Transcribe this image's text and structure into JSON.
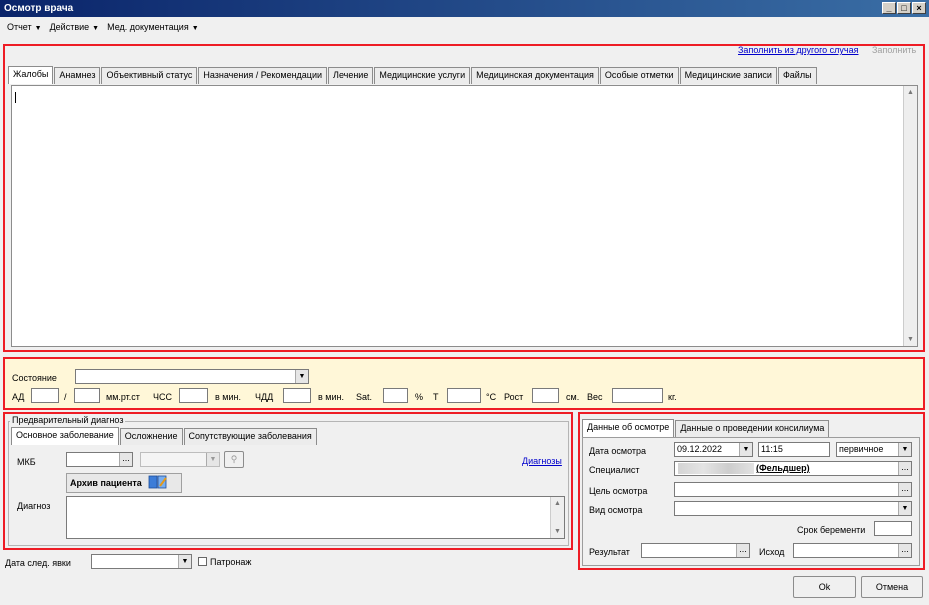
{
  "window": {
    "title": "Осмотр врача"
  },
  "menu": [
    {
      "label": "Отчет"
    },
    {
      "label": "Действие"
    },
    {
      "label": "Мед. документация"
    }
  ],
  "top_links": {
    "fill_from_other": "Заполнить из другого случая",
    "fill": "Заполнить"
  },
  "main_tabs": [
    "Жалобы",
    "Анамнез",
    "Объективный статус",
    "Назначения / Рекомендации",
    "Лечение",
    "Медицинские услуги",
    "Медицинская документация",
    "Особые отметки",
    "Медицинские записи",
    "Файлы"
  ],
  "vitals": {
    "state_label": "Состояние",
    "state_value": "",
    "bp_label": "АД",
    "bp_sep": "/",
    "bp_unit": "мм.рт.ст",
    "hr_label": "ЧСС",
    "hr_unit": "в мин.",
    "rr_label": "ЧДД",
    "rr_unit": "в мин.",
    "sat_label": "Sat.",
    "sat_unit": "%",
    "temp_label": "T",
    "temp_unit": "°C",
    "height_label": "Рост",
    "height_unit": "см.",
    "weight_label": "Вес",
    "weight_unit": "кг."
  },
  "diagnosis": {
    "group_title": "Предварительный диагноз",
    "tabs": [
      "Основное заболевание",
      "Осложнение",
      "Сопутствующие заболевания"
    ],
    "mkb_label": "МКБ",
    "diagnoses_link": "Диагнозы",
    "archive_button": "Архив пациента",
    "diagnosis_label": "Диагноз"
  },
  "next_visit": {
    "label": "Дата след. явки",
    "patronage_label": "Патронаж"
  },
  "exam": {
    "tabs": [
      "Данные об осмотре",
      "Данные о проведении консилиума"
    ],
    "date_label": "Дата осмотра",
    "date_value": "09.12.2022",
    "time_value": "11:15",
    "type_value": "первичное",
    "specialist_label": "Специалист",
    "specialist_value": "(Фельдшер)",
    "purpose_label": "Цель осмотра",
    "kind_label": "Вид осмотра",
    "pregnancy_label": "Срок беременти",
    "result_label": "Результат",
    "outcome_label": "Исход"
  },
  "buttons": {
    "ok": "Ok",
    "cancel": "Отмена"
  },
  "colors": {
    "highlight_border": "#ee1c25",
    "vitals_bg": "#fff7d8",
    "link": "#0000cc"
  }
}
